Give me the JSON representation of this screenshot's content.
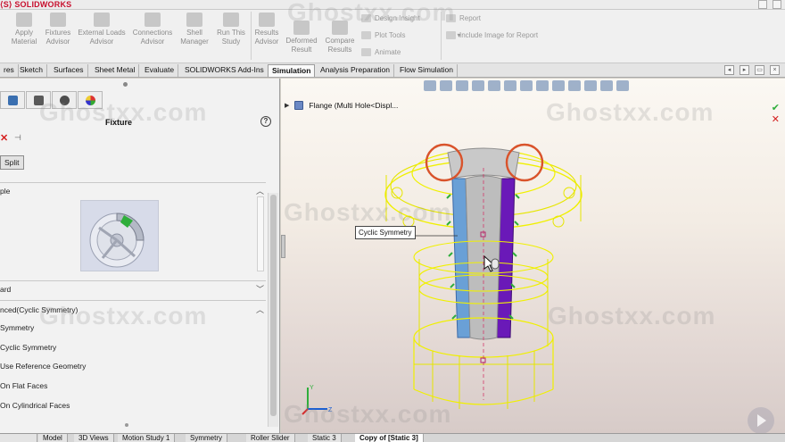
{
  "app": {
    "logo_text": "SOLIDWORKS"
  },
  "ribbon": {
    "buttons": [
      {
        "label": "Apply\nMaterial"
      },
      {
        "label": "Fixtures\nAdvisor"
      },
      {
        "label": "External Loads\nAdvisor"
      },
      {
        "label": "Connections\nAdvisor"
      },
      {
        "label": "Shell\nManager"
      },
      {
        "label": "Run This\nStudy"
      },
      {
        "label": "Results\nAdvisor"
      },
      {
        "label": "Deformed\nResult"
      },
      {
        "label": "Compare\nResults"
      }
    ],
    "small_buttons": [
      {
        "label": "Design Insight"
      },
      {
        "label": "Plot Tools"
      },
      {
        "label": "Animate"
      },
      {
        "label": "Report"
      },
      {
        "label": "Include Image for Report"
      }
    ]
  },
  "tabs": [
    {
      "label": "res"
    },
    {
      "label": "Sketch"
    },
    {
      "label": "Surfaces"
    },
    {
      "label": "Sheet Metal"
    },
    {
      "label": "Evaluate"
    },
    {
      "label": "SOLIDWORKS Add-Ins"
    },
    {
      "label": "Simulation"
    },
    {
      "label": "Analysis Preparation"
    },
    {
      "label": "Flow Simulation"
    }
  ],
  "active_tab": "Simulation",
  "property_manager": {
    "title": "Fixture",
    "split_label": "Split",
    "groups": {
      "example": "ple",
      "standard": "ard",
      "advanced": "nced(Cyclic Symmetry)"
    },
    "options": [
      "Symmetry",
      "Cyclic Symmetry",
      "Use Reference Geometry",
      "On Flat Faces",
      "On Cylindrical Faces"
    ]
  },
  "graphics": {
    "tree_label": "Flange  (Multi Hole<Displ...",
    "callout": "Cyclic Symmetry",
    "triad_labels": {
      "y": "Y",
      "z": "Z"
    },
    "watermark": "Ghostxx.com"
  },
  "bottom_tabs": [
    {
      "label": "Model"
    },
    {
      "label": "3D Views"
    },
    {
      "label": "Motion Study 1"
    },
    {
      "label": "Symmetry"
    },
    {
      "label": "Roller Slider"
    },
    {
      "label": "Static 3"
    },
    {
      "label": "Copy of [Static 3]"
    }
  ],
  "colors": {
    "accent_red": "#c8102e",
    "wireframe_yellow": "#f0f000",
    "cut_face_blue": "#6aa0d6",
    "cut_face_purple": "#6a19b8",
    "fixture_green": "#2fae3b",
    "highlight_circle": "#d9532b"
  }
}
